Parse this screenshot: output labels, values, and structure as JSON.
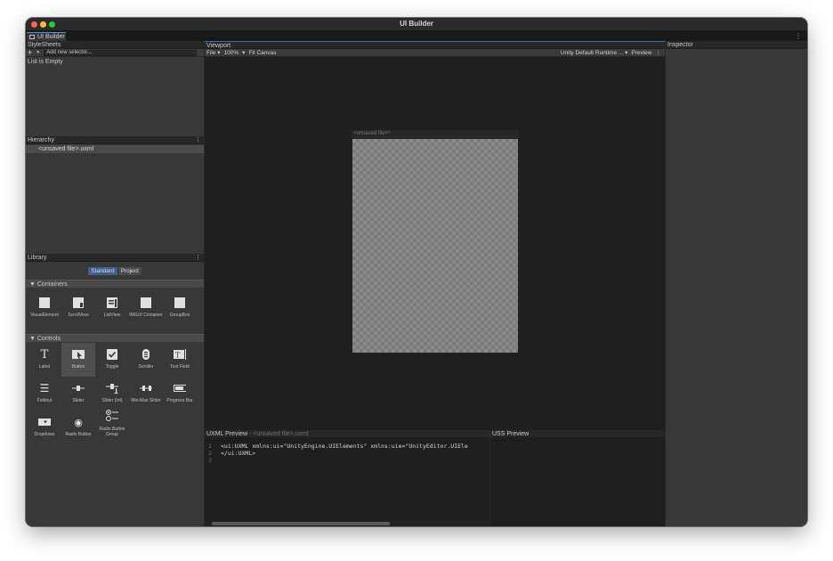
{
  "window": {
    "title": "UI Builder"
  },
  "tab": {
    "label": "UI Builder",
    "menu": "⋮"
  },
  "stylesheets": {
    "title": "StyleSheets",
    "input_placeholder": "Add new selector...",
    "empty_text": "List is Empty"
  },
  "hierarchy": {
    "title": "Hierarchy",
    "items": [
      "<unsaved file>.uxml"
    ]
  },
  "library": {
    "title": "Library",
    "tabs": [
      "Standard",
      "Project"
    ],
    "sections": [
      {
        "name": "Containers",
        "items": [
          "VisualElement",
          "ScrollView",
          "ListView",
          "IMGUI Container",
          "GroupBox"
        ]
      },
      {
        "name": "Controls",
        "items": [
          "Label",
          "Button",
          "Toggle",
          "Scroller",
          "Text Field",
          "Foldout",
          "Slider",
          "Slider (Int)",
          "Min-Max Slider",
          "Progress Bar",
          "Dropdown",
          "Radio Button",
          "Radio Button Group"
        ]
      }
    ]
  },
  "viewport": {
    "title": "Viewport",
    "file_menu": "File ▾",
    "zoom": "100%",
    "fit_canvas": "Fit Canvas",
    "theme": "Unity Default Runtime ... ▾",
    "preview": "Preview",
    "canvas_title": "<unsaved file>*"
  },
  "uxml_preview": {
    "title": "UXML Preview",
    "subtitle": "- <unsaved file>.uxml",
    "lines": [
      "<ui:UXML xmlns:ui=\"UnityEngine.UIElements\" xmlns:uie=\"UnityEditor.UIEle",
      "</ui:UXML>",
      ""
    ]
  },
  "uss_preview": {
    "title": "USS Preview"
  },
  "inspector": {
    "title": "Inspector"
  },
  "icons": {
    "label": "T",
    "button": "▶",
    "toggle": "✔",
    "foldout": "☰",
    "radio": "◉"
  }
}
